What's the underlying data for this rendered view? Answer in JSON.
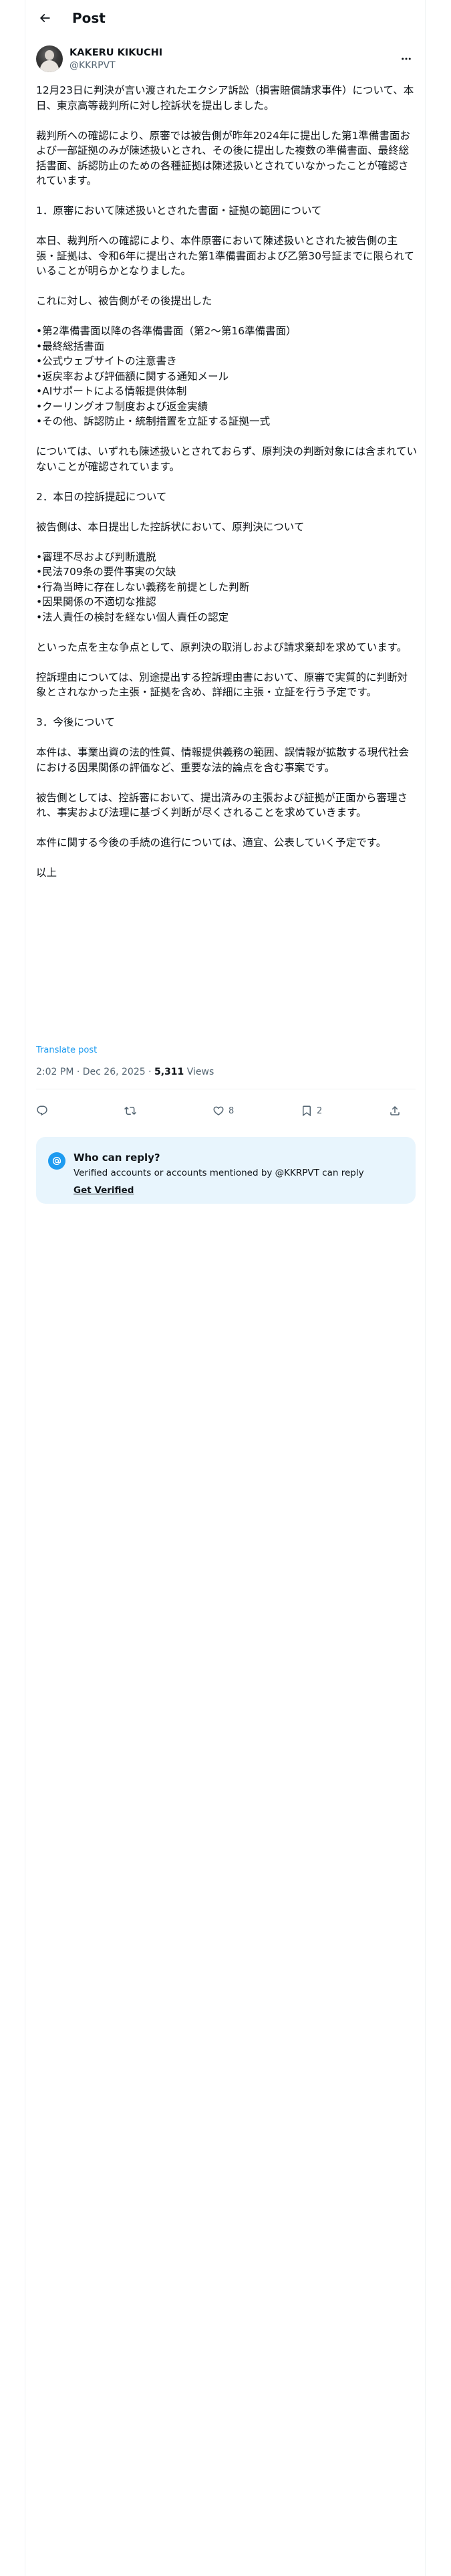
{
  "header": {
    "title": "Post",
    "back_icon": "arrow-left-icon"
  },
  "author": {
    "display_name": "KAKERU KIKUCHI",
    "handle": "@KKRPVT",
    "more_icon": "more-horizontal-icon"
  },
  "post": {
    "text": "12月23日に判決が言い渡されたエクシア訴訟（損害賠償請求事件）について、本日、東京高等裁判所に対し控訴状を提出しました。\n\n裁判所への確認により、原審では被告側が昨年2024年に提出した第1準備書面および一部証拠のみが陳述扱いとされ、その後に提出した複数の準備書面、最終総括書面、訴認防止のための各種証拠は陳述扱いとされていなかったことが確認されています。\n\n1．原審において陳述扱いとされた書面・証拠の範囲について\n\n本日、裁判所への確認により、本件原審において陳述扱いとされた被告側の主張・証拠は、令和6年に提出された第1準備書面および乙第30号証までに限られていることが明らかとなりました。\n\nこれに対し、被告側がその後提出した\n\n•第2準備書面以降の各準備書面（第2〜第16準備書面）\n•最終総括書面\n•公式ウェブサイトの注意書き\n•返戻率および評価額に関する通知メール\n•AIサポートによる情報提供体制\n•クーリングオフ制度および返金実績\n•その他、訴認防止・統制措置を立証する証拠一式\n\nについては、いずれも陳述扱いとされておらず、原判決の判断対象には含まれていないことが確認されています。\n\n2．本日の控訴提起について\n\n被告側は、本日提出した控訴状において、原判決について\n\n•審理不尽および判断遺脱\n•民法709条の要件事実の欠缺\n•行為当時に存在しない義務を前提とした判断\n•因果関係の不適切な推認\n•法人責任の検討を経ない個人責任の認定\n\nといった点を主な争点として、原判決の取消しおよび請求棄却を求めています。\n\n控訴理由については、別途提出する控訴理由書において、原審で実質的に判断対象とされなかった主張・証拠を含め、詳細に主張・立証を行う予定です。\n\n3．今後について\n\n本件は、事業出資の法的性質、情報提供義務の範囲、誤情報が拡散する現代社会における因果関係の評価など、重要な法的論点を含む事案です。\n\n被告側としては、控訴審において、提出済みの主張および証拠が正面から審理され、事実および法理に基づく判断が尽くされることを求めていきます。\n\n本件に関する今後の手続の進行については、適宜、公表していく予定です。\n\n以上",
    "translate_label": "Translate post",
    "timestamp": "2:02 PM · Dec 26, 2025 · ",
    "views_count": "5,311",
    "views_label": " Views"
  },
  "actions": {
    "reply_icon": "reply-icon",
    "repost_icon": "repost-icon",
    "like_icon": "heart-icon",
    "like_count": "8",
    "bookmark_icon": "bookmark-icon",
    "bookmark_count": "2",
    "share_icon": "share-icon"
  },
  "who_can_reply": {
    "icon": "at-sign-icon",
    "title": "Who can reply?",
    "description": "Verified accounts or accounts mentioned by @KKRPVT can reply",
    "link": "Get Verified"
  },
  "colors": {
    "accent": "#1d9bf0",
    "secondary_text": "#536471",
    "reply_box_bg": "#e8f5fd"
  }
}
